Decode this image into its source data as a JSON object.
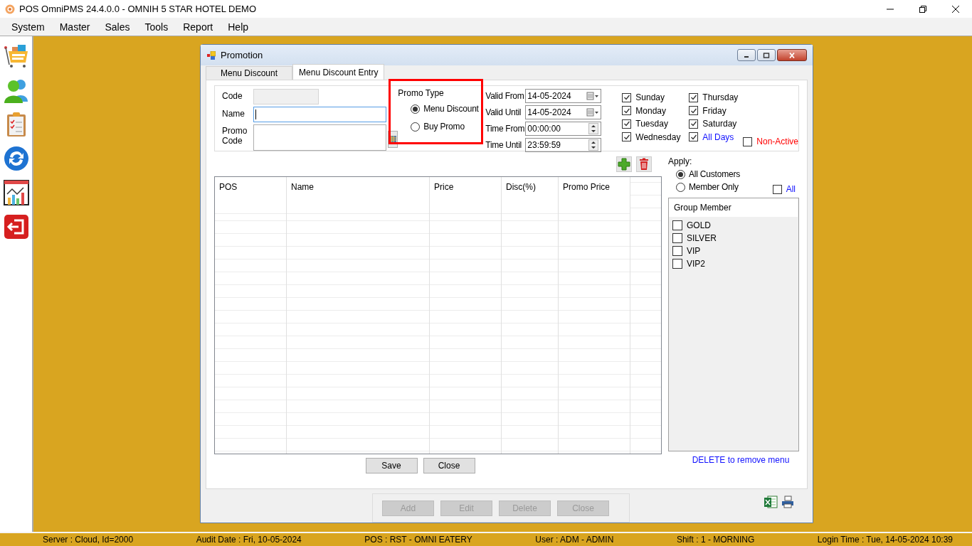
{
  "app": {
    "title": "POS OmniPMS 24.4.0.0 - OMNIH 5 STAR HOTEL DEMO",
    "menu": [
      "System",
      "Master",
      "Sales",
      "Tools",
      "Report",
      "Help"
    ]
  },
  "dialog": {
    "title": "Promotion",
    "tabs": [
      {
        "label": "Menu Discount",
        "selected": false
      },
      {
        "label": "Menu Discount Entry",
        "selected": true
      }
    ],
    "fields": [
      {
        "label": "Code",
        "kind": "readonly"
      },
      {
        "label": "Name",
        "kind": "focused"
      },
      {
        "label": "Promo Code",
        "kind": "area"
      }
    ],
    "promo_type": {
      "title": "Promo Type",
      "options": [
        {
          "label": "Menu Discount",
          "selected": true
        },
        {
          "label": "Buy Promo",
          "selected": false
        }
      ]
    },
    "period": [
      {
        "label": "Valid From",
        "kind": "date",
        "value": "14-05-2024"
      },
      {
        "label": "Valid Until",
        "kind": "date",
        "value": "14-05-2024"
      },
      {
        "label": "Time From",
        "kind": "time",
        "value": "00:00:00"
      },
      {
        "label": "Time Until",
        "kind": "time",
        "value": "23:59:59"
      }
    ],
    "days": [
      {
        "label": "Sunday",
        "kind": "day",
        "checked": true
      },
      {
        "label": "Monday",
        "kind": "day",
        "checked": true
      },
      {
        "label": "Tuesday",
        "kind": "day",
        "checked": true
      },
      {
        "label": "Wednesday",
        "kind": "day",
        "checked": true
      },
      {
        "label": "Thursday",
        "kind": "day",
        "checked": true
      },
      {
        "label": "Friday",
        "kind": "day",
        "checked": true
      },
      {
        "label": "Saturday",
        "kind": "day",
        "checked": true
      },
      {
        "label": "All Days",
        "kind": "all",
        "checked": true
      }
    ],
    "non_active": {
      "label": "Non-Active",
      "checked": false
    },
    "table": {
      "columns": [
        "POS",
        "Name",
        "Price",
        "Disc(%)",
        "Promo Price"
      ]
    },
    "apply": {
      "title": "Apply:",
      "options": [
        {
          "label": "All Customers",
          "selected": true
        },
        {
          "label": "Member Only",
          "selected": false
        }
      ],
      "all": {
        "label": "All",
        "checked": false
      }
    },
    "group_member": {
      "title": "Group Member",
      "items": [
        {
          "label": "GOLD",
          "checked": false
        },
        {
          "label": "SILVER",
          "checked": false
        },
        {
          "label": "VIP",
          "checked": false
        },
        {
          "label": "VIP2",
          "checked": false
        }
      ]
    },
    "buttons": [
      "Save",
      "Close"
    ],
    "hint": "DELETE to remove menu",
    "bottom_buttons": [
      {
        "label": "Add",
        "disabled": true
      },
      {
        "label": "Edit",
        "disabled": true
      },
      {
        "label": "Delete",
        "disabled": true
      },
      {
        "label": "Close",
        "disabled": true
      }
    ]
  },
  "status_bar": [
    "Server : Cloud, Id=2000",
    "Audit Date : Fri, 10-05-2024",
    "POS : RST - OMNI EATERY",
    "User : ADM - ADMIN",
    "Shift : 1 - MORNING",
    "Login Time : Tue, 14-05-2024 10:39"
  ]
}
